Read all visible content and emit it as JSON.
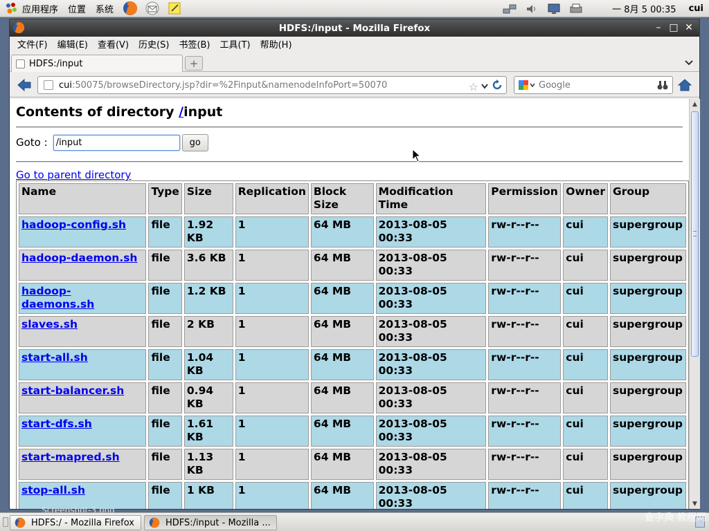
{
  "colors": {
    "row_even_bg": "#add8e6",
    "row_odd_bg": "#d6d6d6",
    "link": "#0000ee",
    "titlebar": "#3a3a3a"
  },
  "panel": {
    "menus": [
      "应用程序",
      "位置",
      "系统"
    ],
    "launchers": [
      "firefox-icon",
      "mail-icon",
      "notes-icon"
    ],
    "tray_icons": [
      "network-icon",
      "volume-icon",
      "display-icon",
      "printer-icon"
    ],
    "clock": "一 8月  5 00:35",
    "user": "cui"
  },
  "window": {
    "title": "HDFS:/input - Mozilla Firefox"
  },
  "menubar": {
    "items": [
      "文件(F)",
      "编辑(E)",
      "查看(V)",
      "历史(S)",
      "书签(B)",
      "工具(T)",
      "帮助(H)"
    ]
  },
  "tabs": {
    "active_label": "HDFS:/input"
  },
  "navbar": {
    "url_host": "cui",
    "url_rest": ":50075/browseDirectory.jsp?dir=%2Finput&namenodeInfoPort=50070",
    "search_placeholder": "Google"
  },
  "page": {
    "heading_prefix": "Contents of directory ",
    "heading_link": "/",
    "heading_suffix": "input",
    "goto_label": "Goto : ",
    "goto_value": "/input",
    "goto_button": "go",
    "parent_link": "Go to parent directory"
  },
  "table": {
    "headers": [
      "Name",
      "Type",
      "Size",
      "Replication",
      "Block Size",
      "Modification Time",
      "Permission",
      "Owner",
      "Group"
    ],
    "rows": [
      [
        "hadoop-config.sh",
        "file",
        "1.92 KB",
        "1",
        "64 MB",
        "2013-08-05 00:33",
        "rw-r--r--",
        "cui",
        "supergroup"
      ],
      [
        "hadoop-daemon.sh",
        "file",
        "3.6 KB",
        "1",
        "64 MB",
        "2013-08-05 00:33",
        "rw-r--r--",
        "cui",
        "supergroup"
      ],
      [
        "hadoop-daemons.sh",
        "file",
        "1.2 KB",
        "1",
        "64 MB",
        "2013-08-05 00:33",
        "rw-r--r--",
        "cui",
        "supergroup"
      ],
      [
        "slaves.sh",
        "file",
        "2 KB",
        "1",
        "64 MB",
        "2013-08-05 00:33",
        "rw-r--r--",
        "cui",
        "supergroup"
      ],
      [
        "start-all.sh",
        "file",
        "1.04 KB",
        "1",
        "64 MB",
        "2013-08-05 00:33",
        "rw-r--r--",
        "cui",
        "supergroup"
      ],
      [
        "start-balancer.sh",
        "file",
        "0.94 KB",
        "1",
        "64 MB",
        "2013-08-05 00:33",
        "rw-r--r--",
        "cui",
        "supergroup"
      ],
      [
        "start-dfs.sh",
        "file",
        "1.61 KB",
        "1",
        "64 MB",
        "2013-08-05 00:33",
        "rw-r--r--",
        "cui",
        "supergroup"
      ],
      [
        "start-mapred.sh",
        "file",
        "1.13 KB",
        "1",
        "64 MB",
        "2013-08-05 00:33",
        "rw-r--r--",
        "cui",
        "supergroup"
      ],
      [
        "stop-all.sh",
        "file",
        "1 KB",
        "1",
        "64 MB",
        "2013-08-05 00:33",
        "rw-r--r--",
        "cui",
        "supergroup"
      ]
    ]
  },
  "taskbar": {
    "tasks": [
      "HDFS:/ - Mozilla Firefox",
      "HDFS:/input - Mozilla ..."
    ],
    "desktop_label": "Screenshot-3.png",
    "watermark": "查字典 教程网"
  }
}
